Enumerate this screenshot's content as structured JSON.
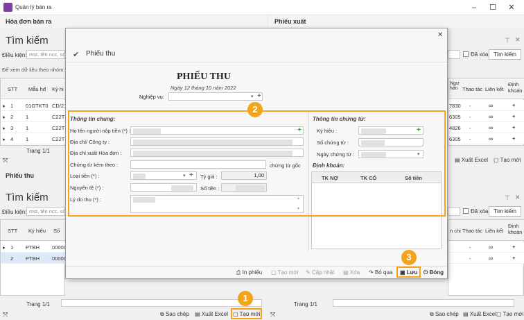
{
  "app": {
    "title": "Quản lý bán ra"
  },
  "left_top": {
    "header": "Hóa đơn bán ra",
    "search_title": "Tìm kiếm",
    "condition_label": "Điều kiện:",
    "condition_placeholder": "mst, tên ncc, số",
    "hint": "Để xem dữ liệu theo nhóm: K",
    "columns": [
      "STT",
      "Mẫu hđ",
      "Ký hi"
    ],
    "rows": [
      [
        "1",
        "01GTKT0",
        "CD/21"
      ],
      [
        "2",
        "1",
        "C22TH"
      ],
      [
        "3",
        "1",
        "C22TH"
      ],
      [
        "4",
        "1",
        "C22TH"
      ]
    ],
    "pager": "Trang 1/1"
  },
  "right_top": {
    "header": "Phiếu xuất",
    "deleted_label": "Đã xóa",
    "search_button": "Tìm kiếm",
    "columns": [
      "Ngư hàn",
      "Thao tác",
      "Liên kết",
      "Định khoản"
    ],
    "rows": [
      [
        "7830",
        "-"
      ],
      [
        "6305",
        "-"
      ],
      [
        "4826",
        "-"
      ],
      [
        "6305",
        "-"
      ]
    ],
    "export_excel": "Xuất Excel",
    "create_new": "Tạo mới"
  },
  "left_bottom": {
    "header": "Phiếu thu",
    "search_title": "Tìm kiếm",
    "condition_label": "Điều kiện:",
    "condition_placeholder": "mst, tên ncc, số",
    "columns": [
      "STT",
      "Ký hiệu",
      "Số"
    ],
    "rows": [
      [
        "1",
        "PTBH",
        "00000"
      ],
      [
        "2",
        "PTBH",
        "00000"
      ]
    ],
    "pager": "Trang 1/1",
    "copy": "Sao chép",
    "export_excel": "Xuất Excel",
    "create_new": "Tạo mới"
  },
  "right_bottom": {
    "deleted_label": "Đã xóa",
    "search_button": "Tìm kiếm",
    "columns": [
      "n chi",
      "Thao tác",
      "Liên kết",
      "Định khoản"
    ],
    "pager": "Trang 1/1",
    "copy": "Sao chép",
    "export_excel": "Xuất Excel",
    "create_new": "Tạo mới"
  },
  "dialog": {
    "title": "Phiếu thu",
    "doc_title": "PHIẾU THU",
    "date": "Ngày 12 tháng 10 năm 2022",
    "business_label": "Nghiệp vụ:",
    "general": {
      "title": "Thông tin chung:",
      "payer": "Họ tên người nộp tiền (*) :",
      "address": "Địa chỉ/ Công ty :",
      "invoice_address": "Địa chỉ xuất Hóa đơn :",
      "attached": "Chứng từ kèm theo :",
      "original": "chứng từ gốc",
      "currency_type": "Loại tiền (*) :",
      "rate_label": "Tỷ giá :",
      "rate_value": "1,00",
      "amount_orig": "Nguyên tệ (*) :",
      "amount": "Số tiền :",
      "reason": "Lý do thu (*) :"
    },
    "voucher": {
      "title": "Thông tin chứng từ:",
      "symbol": "Ký hiệu :",
      "number": "Số chứng từ :",
      "date": "Ngày chứng từ :"
    },
    "accounting": {
      "title": "Định khoản:",
      "columns": [
        "TK NỢ",
        "TK CÓ",
        "Số tiền"
      ]
    },
    "toolbar": {
      "print": "In phiếu",
      "new": "Tạo mới",
      "update": "Cập nhật",
      "delete": "Xóa",
      "skip": "Bỏ qua",
      "save": "Lưu",
      "close": "Đóng"
    }
  },
  "callouts": [
    "1",
    "2",
    "3"
  ],
  "colors": {
    "accent": "#f2a51a",
    "plus": "#2e9e2e",
    "app_icon": "#7b3fa0"
  }
}
